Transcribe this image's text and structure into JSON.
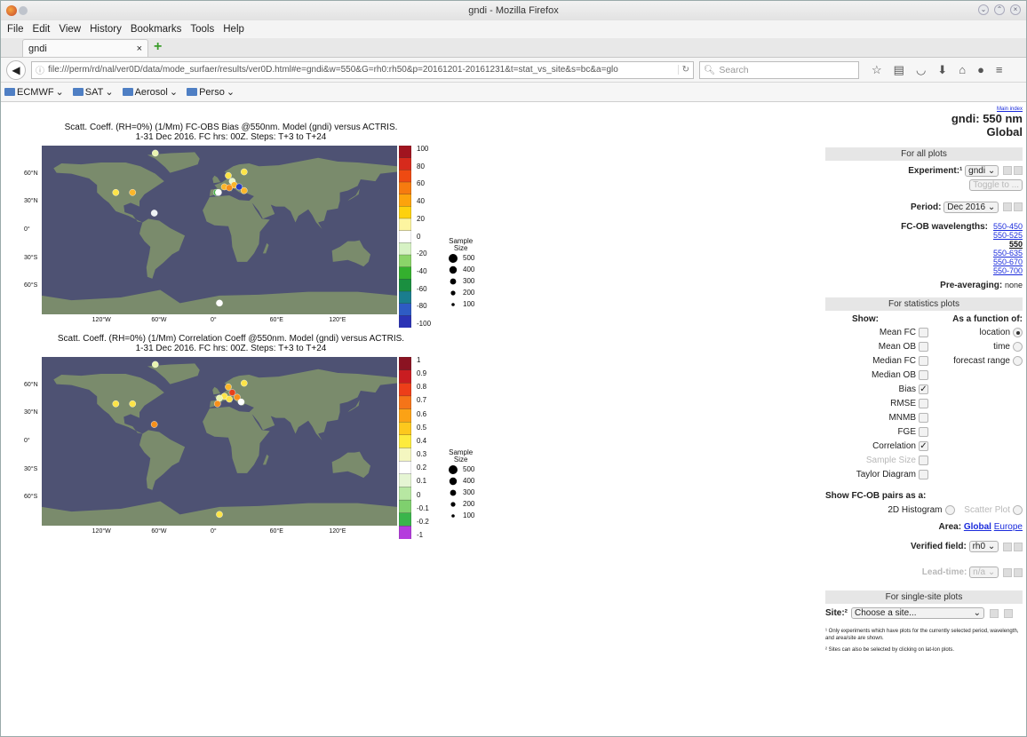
{
  "window": {
    "title": "gndi - Mozilla Firefox"
  },
  "menu": [
    "File",
    "Edit",
    "View",
    "History",
    "Bookmarks",
    "Tools",
    "Help"
  ],
  "tab": {
    "label": "gndi",
    "close": "×",
    "new": "+"
  },
  "nav": {
    "url": "file:///perm/rd/nal/ver0D/data/mode_surfaer/results/ver0D.html#e=gndi&w=550&G=rh0:rh50&p=20161201-20161231&t=stat_vs_site&s=bc&a=glo",
    "search_placeholder": "Search"
  },
  "bookmarks": [
    "ECMWF",
    "SAT",
    "Aerosol",
    "Perso"
  ],
  "plots": [
    {
      "title1": "Scatt. Coeff. (RH=0%) (1/Mm) FC-OBS Bias @550nm. Model (gndi) versus ACTRIS.",
      "title2": "1-31 Dec 2016. FC hrs: 00Z. Steps: T+3 to T+24",
      "cb_labels": [
        "100",
        "80",
        "60",
        "40",
        "20",
        "0",
        "-20",
        "-40",
        "-60",
        "-80",
        "-100"
      ],
      "cb_colors": [
        "#a1141f",
        "#d62a1c",
        "#ee4a12",
        "#f67b0f",
        "#fca30c",
        "#fdd10e",
        "#fdf5a0",
        "#ffffff",
        "#d6f2c4",
        "#8bd469",
        "#34b02e",
        "#1a8f40",
        "#1a7d8e",
        "#2e5bc4",
        "#2b33b5"
      ],
      "points": [
        {
          "lon": -65,
          "lat": 82,
          "color": "#e9f4b0"
        },
        {
          "lon": -105,
          "lat": 40,
          "color": "#fde447"
        },
        {
          "lon": -88,
          "lat": 40,
          "color": "#fbb62a"
        },
        {
          "lon": -66,
          "lat": 18,
          "color": "#eef3f6"
        },
        {
          "lon": 9,
          "lat": 58,
          "color": "#fde447"
        },
        {
          "lon": 25,
          "lat": 62,
          "color": "#fde447"
        },
        {
          "lon": 13,
          "lat": 52,
          "color": "#e9f5c7"
        },
        {
          "lon": 15,
          "lat": 48,
          "color": "#fbb62a"
        },
        {
          "lon": 20,
          "lat": 46,
          "color": "#2a3fbf"
        },
        {
          "lon": 5,
          "lat": 46,
          "color": "#fbb62a"
        },
        {
          "lon": 10,
          "lat": 45,
          "color": "#f7901b"
        },
        {
          "lon": 25,
          "lat": 42,
          "color": "#fbb62a"
        },
        {
          "lon": -3,
          "lat": 40,
          "color": "#4cb04a"
        },
        {
          "lon": -1,
          "lat": 40,
          "color": "#ffffff"
        },
        {
          "lon": 0,
          "lat": -78,
          "color": "#ffffff"
        }
      ],
      "size_legend": {
        "title": "Sample\nSize",
        "values": [
          "500",
          "400",
          "300",
          "200",
          "100"
        ]
      }
    },
    {
      "title1": "Scatt. Coeff. (RH=0%) (1/Mm) Correlation Coeff @550nm. Model (gndi) versus ACTRIS.",
      "title2": "1-31 Dec 2016. FC hrs: 00Z. Steps: T+3 to T+24",
      "cb_labels": [
        "1",
        "0.9",
        "0.8",
        "0.7",
        "0.6",
        "0.5",
        "0.4",
        "0.3",
        "0.2",
        "0.1",
        "0",
        "-0.1",
        "-0.2",
        "-1"
      ],
      "cb_colors": [
        "#8b1322",
        "#c91d21",
        "#ed3e19",
        "#f57418",
        "#fba215",
        "#fdc81d",
        "#fdeb3d",
        "#f4f6c0",
        "#ffffff",
        "#e5f5d3",
        "#b7e7a2",
        "#7fd06e",
        "#3ab54b",
        "#b43cdd"
      ],
      "points": [
        {
          "lon": -65,
          "lat": 82,
          "color": "#e9f4b0"
        },
        {
          "lon": -105,
          "lat": 40,
          "color": "#fde447"
        },
        {
          "lon": -88,
          "lat": 40,
          "color": "#fde447"
        },
        {
          "lon": -66,
          "lat": 18,
          "color": "#f7901b"
        },
        {
          "lon": 9,
          "lat": 58,
          "color": "#fbb62a"
        },
        {
          "lon": 25,
          "lat": 62,
          "color": "#fde447"
        },
        {
          "lon": 13,
          "lat": 52,
          "color": "#e8401a"
        },
        {
          "lon": 5,
          "lat": 48,
          "color": "#fde447"
        },
        {
          "lon": 10,
          "lat": 45,
          "color": "#fde447"
        },
        {
          "lon": 18,
          "lat": 47,
          "color": "#f7901b"
        },
        {
          "lon": 0,
          "lat": 46,
          "color": "#e9f4b0"
        },
        {
          "lon": 22,
          "lat": 42,
          "color": "#ffffff"
        },
        {
          "lon": -2,
          "lat": 40,
          "color": "#f7901b"
        },
        {
          "lon": 0,
          "lat": -78,
          "color": "#fde447"
        }
      ],
      "size_legend": {
        "title": "Sample\nSize",
        "values": [
          "500",
          "400",
          "300",
          "200",
          "100"
        ]
      }
    }
  ],
  "axes": {
    "lat_labels": [
      "60°N",
      "30°N",
      "0°",
      "30°S",
      "60°S"
    ],
    "lon_labels": [
      "120°W",
      "60°W",
      "0°",
      "60°E",
      "120°E"
    ]
  },
  "panel": {
    "main_index": "Main index",
    "title": "gndi: 550 nm",
    "subtitle": "Global",
    "sect_all": "For all plots",
    "experiment_label": "Experiment:¹",
    "experiment_value": "gndi",
    "toggle_label": "Toggle to ...",
    "period_label": "Period:",
    "period_value": "Dec 2016",
    "wavelengths_label": "FC-OB wavelengths:",
    "wavelengths": [
      "550-450",
      "550-525",
      "550",
      "550-635",
      "550-670",
      "550-700"
    ],
    "preavg_label": "Pre-averaging:",
    "preavg_value": "none",
    "sect_stats": "For statistics plots",
    "show_label": "Show:",
    "function_label": "As a function of:",
    "show_items": [
      {
        "label": "Mean FC",
        "checked": false,
        "enabled": true
      },
      {
        "label": "Mean OB",
        "checked": false,
        "enabled": true
      },
      {
        "label": "Median FC",
        "checked": false,
        "enabled": true
      },
      {
        "label": "Median OB",
        "checked": false,
        "enabled": true
      },
      {
        "label": "Bias",
        "checked": true,
        "enabled": true
      },
      {
        "label": "RMSE",
        "checked": false,
        "enabled": true
      },
      {
        "label": "MNMB",
        "checked": false,
        "enabled": true
      },
      {
        "label": "FGE",
        "checked": false,
        "enabled": true
      },
      {
        "label": "Correlation",
        "checked": true,
        "enabled": true
      },
      {
        "label": "Sample Size",
        "checked": false,
        "enabled": false
      },
      {
        "label": "Taylor Diagram",
        "checked": false,
        "enabled": true
      }
    ],
    "function_items": [
      {
        "label": "location",
        "selected": true
      },
      {
        "label": "time",
        "selected": false
      },
      {
        "label": "forecast range",
        "selected": false
      }
    ],
    "pairs_label": "Show FC-OB pairs as a:",
    "hist_label": "2D Histogram",
    "scatter_label": "Scatter Plot",
    "area_label": "Area:",
    "area_global": "Global",
    "area_europe": "Europe",
    "verified_label": "Verified field:",
    "verified_value": "rh0",
    "leadtime_label": "Lead-time:",
    "leadtime_value": "n/a",
    "sect_single": "For single-site plots",
    "site_label": "Site:²",
    "site_value": "Choose a site...",
    "note1": "¹ Only experiments which have plots for the currently selected period, wavelength, and area/site are shown.",
    "note2": "² Sites can also be selected by clicking on lat-lon plots."
  }
}
